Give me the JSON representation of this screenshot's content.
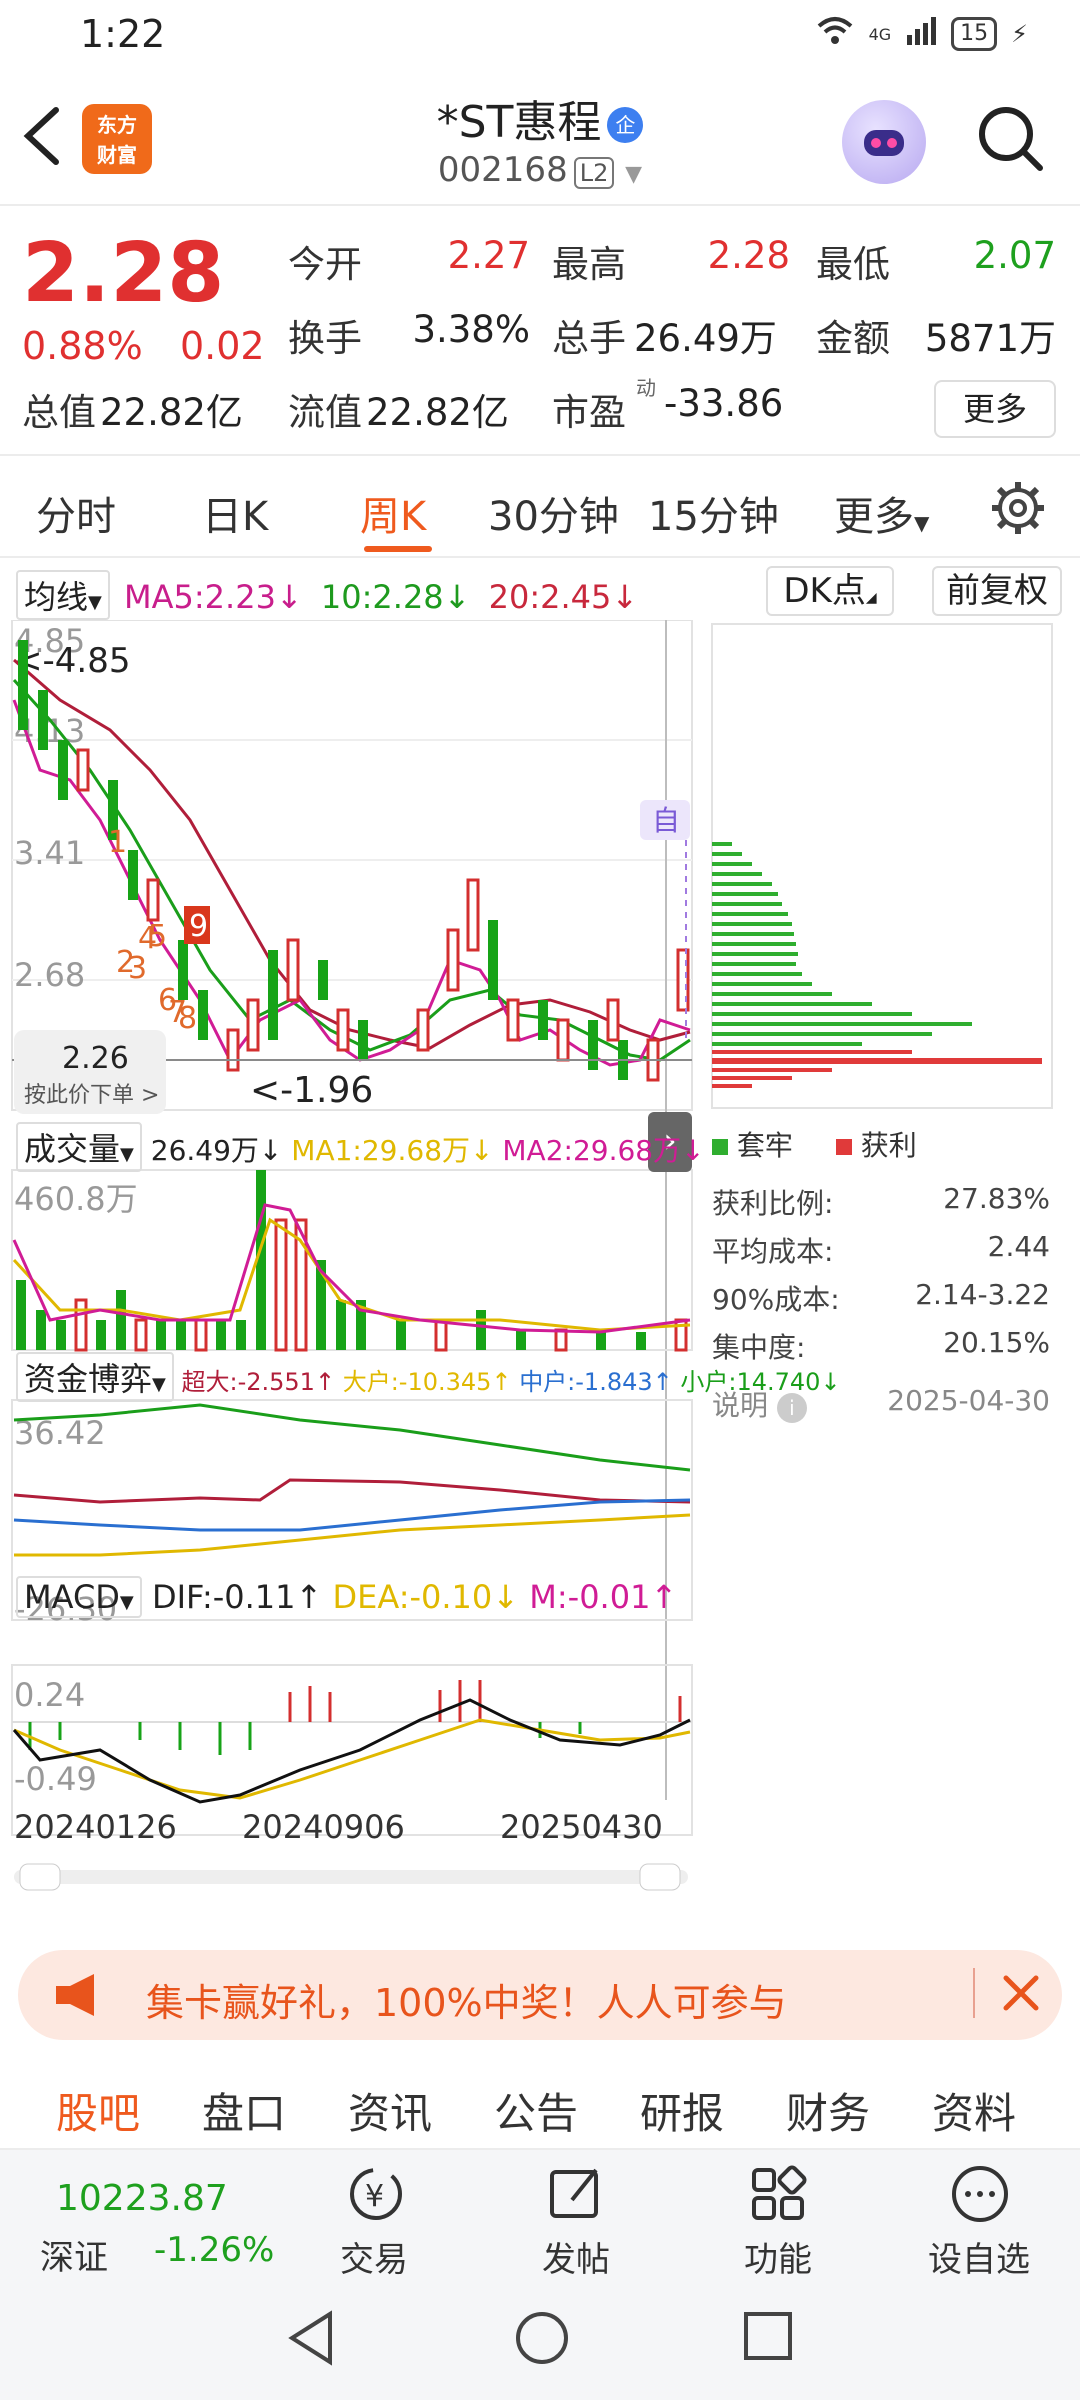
{
  "status": {
    "time": "1:22",
    "network": "4G",
    "battery": "15"
  },
  "header": {
    "title": "*ST惠程",
    "corp_badge": "企",
    "code": "002168",
    "level": "L2",
    "logo_line1": "东方",
    "logo_line2": "财富"
  },
  "quote": {
    "price": "2.28",
    "pct": "0.88%",
    "change": "0.02",
    "open_label": "今开",
    "open": "2.27",
    "high_label": "最高",
    "high": "2.28",
    "low_label": "最低",
    "low": "2.07",
    "turnover_label": "换手",
    "turnover": "3.38%",
    "volume_label": "总手",
    "volume": "26.49万",
    "amount_label": "金额",
    "amount": "5871万",
    "mcap_label": "总值",
    "mcap": "22.82亿",
    "float_label": "流值",
    "float": "22.82亿",
    "pe_label": "市盈",
    "pe_sup": "动",
    "pe": "-33.86",
    "more": "更多"
  },
  "tabs": {
    "t1": "分时",
    "t2": "日K",
    "t3": "周K",
    "t4": "30分钟",
    "t5": "15分钟",
    "t6": "更多"
  },
  "ma_row": {
    "selector": "均线",
    "ma5": "MA5:2.23↓",
    "ma10": "10:2.28↓",
    "ma20": "20:2.45↓",
    "dk": "DK点",
    "fq": "前复权"
  },
  "kline": {
    "max_label": "4.85",
    "min_label": "1.96",
    "arrow_max": "<-4.85",
    "arrow_min": "<-1.96",
    "y_413": "4.13",
    "y_341": "3.41",
    "y_268": "2.68",
    "price_tag": "2.26",
    "order_hint": "按此价下单 >",
    "zi": "自",
    "markers": [
      "1",
      "2",
      "3",
      "4",
      "5",
      "6",
      "7",
      "8",
      "9"
    ]
  },
  "volume_row": {
    "selector": "成交量",
    "vol": "26.49万↓",
    "ma1": "MA1:29.68万↓",
    "ma2": "MA2:29.68万↓",
    "max": "460.8万"
  },
  "fund_row": {
    "selector": "资金博弈",
    "super": "超大:-2.551↑",
    "big": "大户:-10.345↑",
    "mid": "中户:-1.843↑",
    "small": "小户:14.740↓",
    "y_top": "36.42",
    "y_bot": "-26.30"
  },
  "macd_row": {
    "selector": "MACD",
    "dif": "DIF:-0.11↑",
    "dea": "DEA:-0.10↓",
    "m": "M:-0.01↑",
    "y_top": "0.24",
    "y_bot": "-0.49"
  },
  "dates": {
    "d1": "20240126",
    "d2": "20240906",
    "d3": "20250430"
  },
  "chips": {
    "legend_trapped": "套牢",
    "legend_profit": "获利",
    "profit_ratio_label": "获利比例:",
    "profit_ratio": "27.83%",
    "avg_cost_label": "平均成本:",
    "avg_cost": "2.44",
    "cost90_label": "90%成本:",
    "cost90": "2.14-3.22",
    "concentration_label": "集中度:",
    "concentration": "20.15%",
    "note_label": "说明",
    "date": "2025-04-30",
    "colors": {
      "trapped": "#2fae2f",
      "profit": "#e03a3a"
    }
  },
  "promo": {
    "text": "集卡赢好礼，100%中奖！人人可参与"
  },
  "sub_nav": [
    "股吧",
    "盘口",
    "资讯",
    "公告",
    "研报",
    "财务",
    "资料"
  ],
  "bottom": {
    "index_value": "10223.87",
    "index_name": "深证",
    "index_pct": "-1.26%",
    "trade": "交易",
    "post": "发帖",
    "func": "功能",
    "watch": "设自选"
  }
}
